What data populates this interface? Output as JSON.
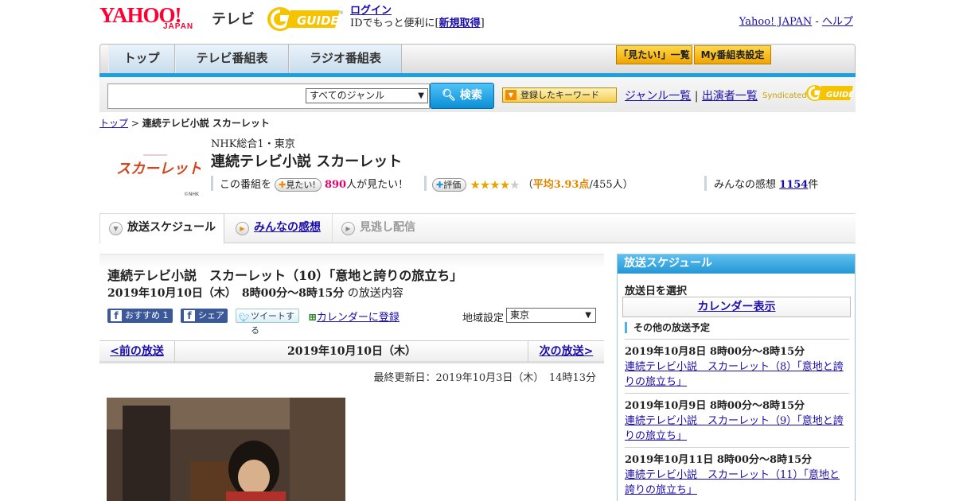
{
  "header": {
    "logo_main": "YAHOO!",
    "logo_sub": "JAPAN",
    "logo_service": "テレビ",
    "gguide_logo": "G-GUIDE",
    "login_link": "ログイン",
    "login_text_pre": "IDでもっと便利に[",
    "signup_link": "新規取得",
    "login_text_post": "]",
    "yahoo_japan_link": "Yahoo! JAPAN",
    "link_sep": " - ",
    "help_link": "ヘルプ"
  },
  "nav": {
    "tabs": [
      "トップ",
      "テレビ番組表",
      "ラジオ番組表"
    ],
    "buttons": [
      "「見たい!」一覧",
      "My番組表設定"
    ]
  },
  "search": {
    "placeholder": "",
    "genre_selected": "すべてのジャンル",
    "search_button": "検索",
    "keyword_button": "登録したキーワード",
    "genre_list_link": "ジャンル一覧",
    "link_divider": "|",
    "performer_list_link": "出演者一覧",
    "syndicated_label": "Syndicated"
  },
  "breadcrumb": {
    "top": "トップ",
    "separator": ">",
    "current": "連続テレビ小説 スカーレット"
  },
  "program": {
    "thumb_text": "スカーレット",
    "thumb_credit": "©NHK",
    "network": "NHK総合1・東京",
    "title": "連続テレビ小説 スカーレット",
    "want_prefix": "この番組を",
    "want_button": "見たい!",
    "want_count": "890",
    "want_suffix": "人が見たい！",
    "rate_button": "評価",
    "rating_open": "（",
    "rating_avg": "平均3.93点",
    "rating_count": "/455人）",
    "stars_filled": "★★★★",
    "stars_empty": "★",
    "rating": 3.93,
    "review_prefix": "みんなの感想",
    "review_count": "1154",
    "review_suffix": "件"
  },
  "tabs": {
    "schedule": "放送スケジュール",
    "reviews": "みんなの感想",
    "missed": "見逃し配信"
  },
  "episode": {
    "title": "連続テレビ小説　スカーレット（10）「意地と誇りの旅立ち」",
    "date_time": "2019年10月10日（木）　8時00分～8時15分",
    "date_suffix": "の放送内容",
    "recommend_button": "おすすめ",
    "recommend_count": "1",
    "share_button": "シェア",
    "tweet_button": "ツイートする",
    "calendar_link": "カレンダーに登録",
    "region_label": "地域設定",
    "region_selected": "東京",
    "prev": "<前の放送",
    "current_date": "2019年10月10日（木）",
    "next": "次の放送>",
    "updated": "最終更新日：2019年10月3日（木）　14時13分"
  },
  "sidebar": {
    "header": "放送スケジュール",
    "select_label": "放送日を選択",
    "calendar_button": "カレンダー表示",
    "other_label": "その他の放送予定",
    "items": [
      {
        "when": "2019年10月8日  8時00分～8時15分",
        "title": "連続テレビ小説　スカーレット（8）「意地と誇りの旅立ち」"
      },
      {
        "when": "2019年10月9日  8時00分～8時15分",
        "title": "連続テレビ小説　スカーレット（9）「意地と誇りの旅立ち」"
      },
      {
        "when": "2019年10月11日  8時00分～8時15分",
        "title": "連続テレビ小説　スカーレット（11）「意地と誇りの旅立ち」"
      }
    ]
  },
  "colors": {
    "accent_blue": "#1e9fe0",
    "link": "#1a0dab",
    "yahoo_red": "#ff0033",
    "want_pink": "#e5006e",
    "rating_orange": "#e58600"
  }
}
